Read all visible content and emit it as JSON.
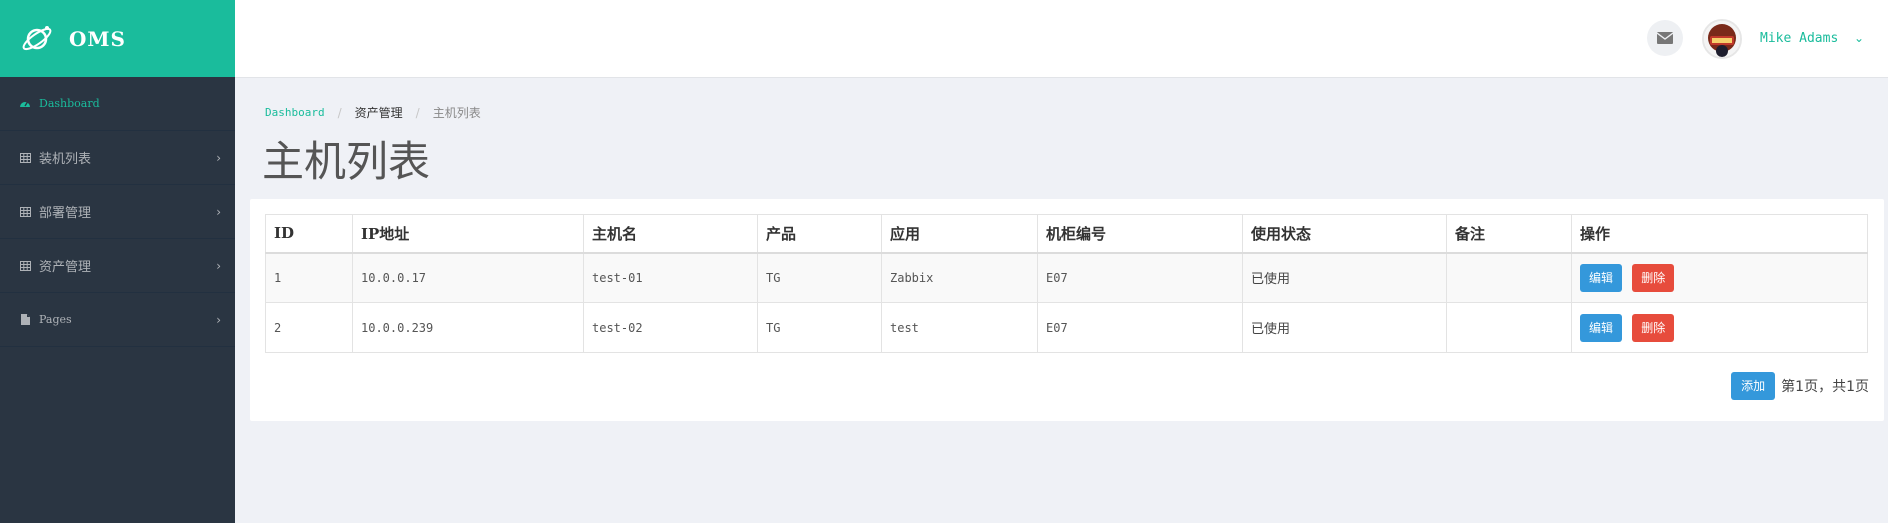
{
  "brand": {
    "name": "OMS"
  },
  "sidebar": {
    "items": [
      {
        "label": "Dashboard",
        "icon": "dashboard-icon",
        "active": true
      },
      {
        "label": "装机列表",
        "icon": "table-icon"
      },
      {
        "label": "部署管理",
        "icon": "table-icon"
      },
      {
        "label": "资产管理",
        "icon": "table-icon"
      },
      {
        "label": "Pages",
        "icon": "file-icon"
      }
    ]
  },
  "header": {
    "user_name": "Mike Adams",
    "mail_icon": "envelope-icon"
  },
  "breadcrumb": {
    "home": "Dashboard",
    "section": "资产管理",
    "current": "主机列表"
  },
  "page": {
    "title": "主机列表"
  },
  "table": {
    "headers": [
      "ID",
      "IP地址",
      "主机名",
      "产品",
      "应用",
      "机柜编号",
      "使用状态",
      "备注",
      "操作"
    ],
    "rows": [
      {
        "id": "1",
        "ip": "10.0.0.17",
        "hostname": "test-01",
        "product": "TG",
        "app": "Zabbix",
        "cabinet": "E07",
        "status": "已使用",
        "note": ""
      },
      {
        "id": "2",
        "ip": "10.0.0.239",
        "hostname": "test-02",
        "product": "TG",
        "app": "test",
        "cabinet": "E07",
        "status": "已使用",
        "note": ""
      }
    ],
    "edit_label": "编辑",
    "delete_label": "删除"
  },
  "pager": {
    "add_label": "添加",
    "info": "第1页，共1页"
  },
  "colors": {
    "accent": "#1abc9c",
    "sidebar_bg": "#2a3542",
    "primary": "#3498db",
    "danger": "#e74c3c"
  }
}
